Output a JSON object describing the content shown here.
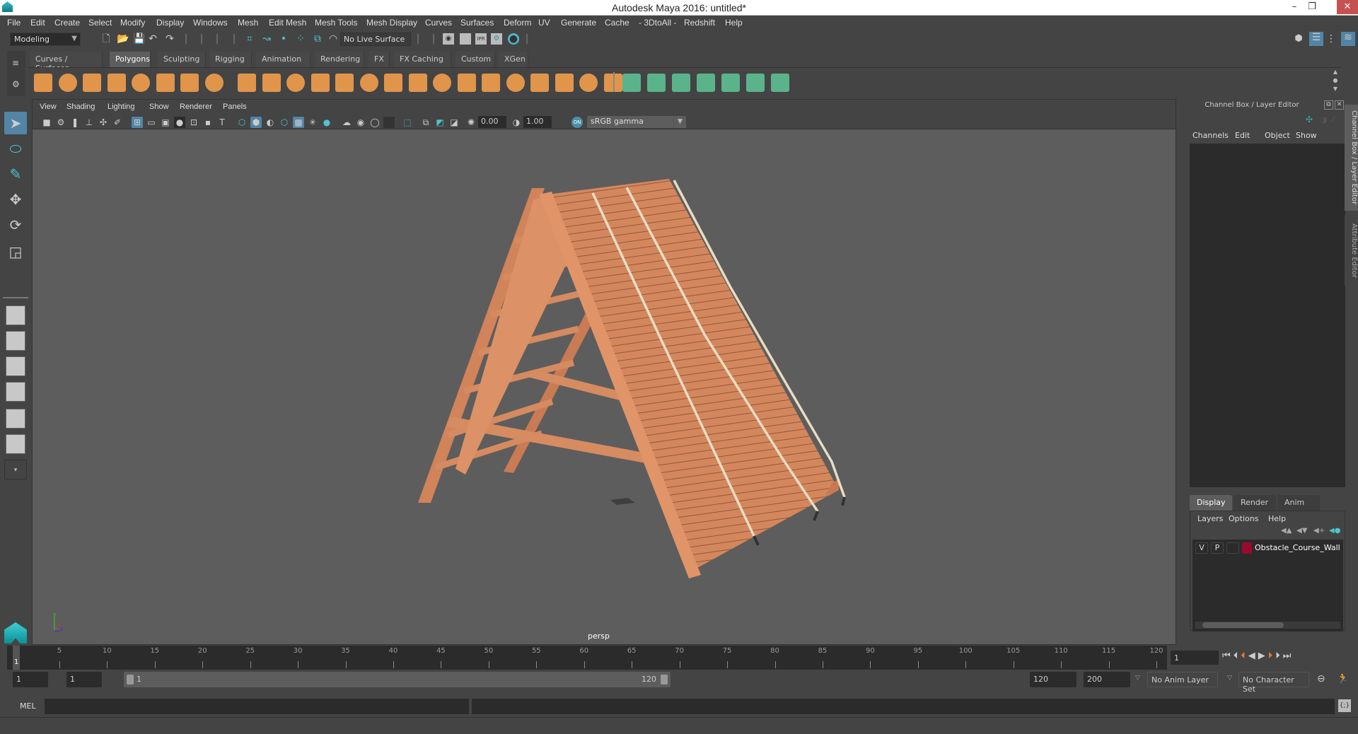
{
  "window": {
    "title": "Autodesk Maya 2016: untitled*",
    "minimize": "–",
    "maximize": "❐",
    "close": "✕"
  },
  "menubar": [
    "File",
    "Edit",
    "Create",
    "Select",
    "Modify",
    "Display",
    "Windows",
    "Mesh",
    "Edit Mesh",
    "Mesh Tools",
    "Mesh Display",
    "Curves",
    "Surfaces",
    "Deform",
    "UV",
    "Generate",
    "Cache",
    "- 3DtoAll -",
    "Redshift",
    "Help"
  ],
  "statusline": {
    "mode": "Modeling",
    "live_surface": "No Live Surface",
    "icons": [
      "new-scene-icon",
      "open-scene-icon",
      "save-scene-icon",
      "undo-icon",
      "redo-icon",
      "snap-grid-icon",
      "snap-curve-icon",
      "snap-point-icon",
      "snap-view-plane-icon",
      "snap-live-icon",
      "make-live-icon",
      "render-view-icon",
      "render-frame-icon",
      "ipr-render-icon",
      "render-settings-icon",
      "hypershade-icon"
    ]
  },
  "shelf": {
    "tabs": [
      "Curves / Surfaces",
      "Polygons",
      "Sculpting",
      "Rigging",
      "Animation",
      "Rendering",
      "FX",
      "FX Caching",
      "Custom",
      "XGen"
    ],
    "active_tab": "Polygons",
    "icons_orange": [
      "poly-sphere-icon",
      "poly-cube-icon",
      "poly-cylinder-icon",
      "poly-cone-icon",
      "poly-plane-icon",
      "poly-torus-icon",
      "poly-pyramid-icon",
      "poly-pipe-icon",
      "combine-icon",
      "separate-icon",
      "mirror-icon",
      "smooth-icon",
      "reduce-icon",
      "subdivide-icon",
      "multi-cut-icon",
      "extrude-icon",
      "bridge-icon",
      "bevel-icon",
      "append-icon",
      "merge-icon",
      "fill-hole-icon",
      "collapse-icon",
      "poke-icon",
      "wedge-icon"
    ],
    "icons_green": [
      "planar-map-icon",
      "cylindrical-map-icon",
      "spherical-map-icon",
      "automatic-map-icon",
      "contour-stretch-icon",
      "uv-editor-icon",
      "unfold-icon"
    ]
  },
  "toolbox": [
    "select-tool-icon",
    "lasso-tool-icon",
    "paint-select-icon",
    "move-tool-icon",
    "rotate-tool-icon",
    "scale-tool-icon"
  ],
  "viewport": {
    "menus": [
      "View",
      "Shading",
      "Lighting",
      "Show",
      "Renderer",
      "Panels"
    ],
    "exposure": "0.00",
    "gamma": "1.00",
    "color_management": "sRGB gamma",
    "camera_label": "persp",
    "axis": {
      "y": "y",
      "x": "x",
      "z": "z"
    }
  },
  "channel_box": {
    "title": "Channel Box / Layer Editor",
    "menus": [
      "Channels",
      "Edit",
      "Object",
      "Show"
    ]
  },
  "layer_editor": {
    "tabs": [
      "Display",
      "Render",
      "Anim"
    ],
    "active_tab": "Display",
    "menus": [
      "Layers",
      "Options",
      "Help"
    ],
    "layers": [
      {
        "v": "V",
        "p": "P",
        "color": "#9b0a2a",
        "name": "Obstacle_Course_Wall_C"
      }
    ]
  },
  "side_tabs": [
    "Channel Box / Layer Editor",
    "Attribute Editor"
  ],
  "timeline": {
    "start": 1,
    "end": 120,
    "current_frame": "1",
    "ticks": [
      5,
      10,
      15,
      20,
      25,
      30,
      35,
      40,
      45,
      50,
      55,
      60,
      65,
      70,
      75,
      80,
      85,
      90,
      95,
      100,
      105,
      110,
      115,
      120
    ],
    "current_frame_field": "1"
  },
  "range": {
    "start_time": "1",
    "playback_start": "1",
    "slider_start": "1",
    "slider_end": "120",
    "playback_end": "120",
    "end_time": "200",
    "anim_layer": "No Anim Layer",
    "character_set": "No Character Set"
  },
  "command_line": {
    "label": "MEL"
  }
}
